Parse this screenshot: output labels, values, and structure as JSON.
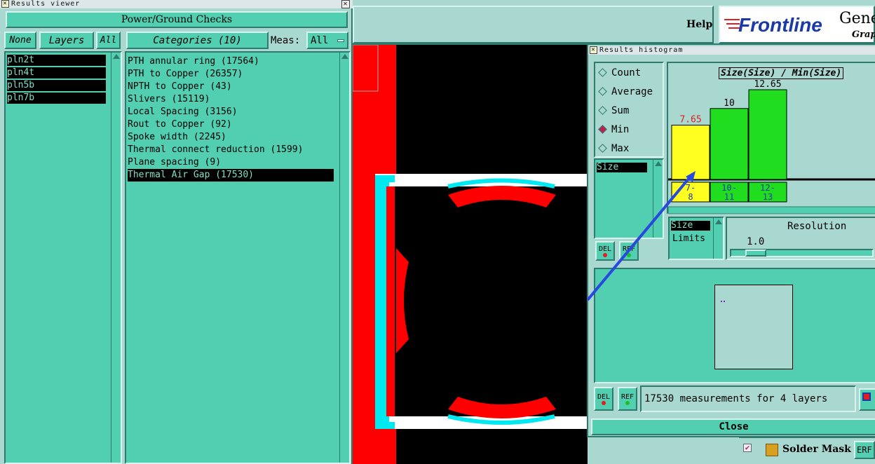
{
  "results_viewer": {
    "title": "Results viewer",
    "header": "Power/Ground Checks",
    "none_btn": "None",
    "layers_btn": "Layers",
    "all_btn": "All",
    "layers": [
      "pln2t",
      "pln4t",
      "pln5b",
      "pln7b"
    ],
    "categories_btn": "Categories (10)",
    "meas_label": "Meas:",
    "meas_value": "All",
    "categories": [
      "PTH annular ring (17564)",
      "PTH to Copper (26357)",
      "NPTH to Copper (43)",
      "Slivers (15119)",
      "Local Spacing (3156)",
      "Rout to Copper (92)",
      "Spoke width (2245)",
      "Thermal connect reduction (1599)",
      "Plane spacing (9)",
      "Thermal Air Gap (17530)"
    ],
    "selected_category_index": 9
  },
  "main_app": {
    "help_label": "Help",
    "brand": "Frontline",
    "brand_sub1": "Gene",
    "brand_sub2": "Grap"
  },
  "histogram": {
    "title": "Results histogram",
    "modes": [
      "Count",
      "Average",
      "Sum",
      "Min",
      "Max"
    ],
    "selected_mode": "Min",
    "chart_title": "Size(Size) / Min(Size)",
    "size_list_item": "Size",
    "del_label": "DEL",
    "ref_label": "REF",
    "size_label": "Size",
    "limits_label": "Limits",
    "resolution_label": "Resolution",
    "resolution_value": "1.0",
    "status": "17530 measurements for 4 layers",
    "close_label": "Close"
  },
  "chart_data": {
    "type": "bar",
    "title": "Size(Size) / Min(Size)",
    "categories": [
      "7-8",
      "10-11",
      "12-13"
    ],
    "category_labels": [
      [
        "7-",
        "8"
      ],
      [
        "10-",
        "11"
      ],
      [
        "12-",
        "13"
      ]
    ],
    "values": [
      7.65,
      10,
      12.65
    ],
    "value_labels": [
      "7.65",
      "10",
      "12.65"
    ],
    "colors": [
      "#ffff20",
      "#20dd20",
      "#20dd20"
    ],
    "label_colors": [
      "#e02020",
      "#000000",
      "#000000"
    ],
    "ylim": [
      0,
      12.65
    ]
  },
  "bottom_bar": {
    "item_label": "Solder Mask Ch",
    "erf_label": "ERF"
  }
}
